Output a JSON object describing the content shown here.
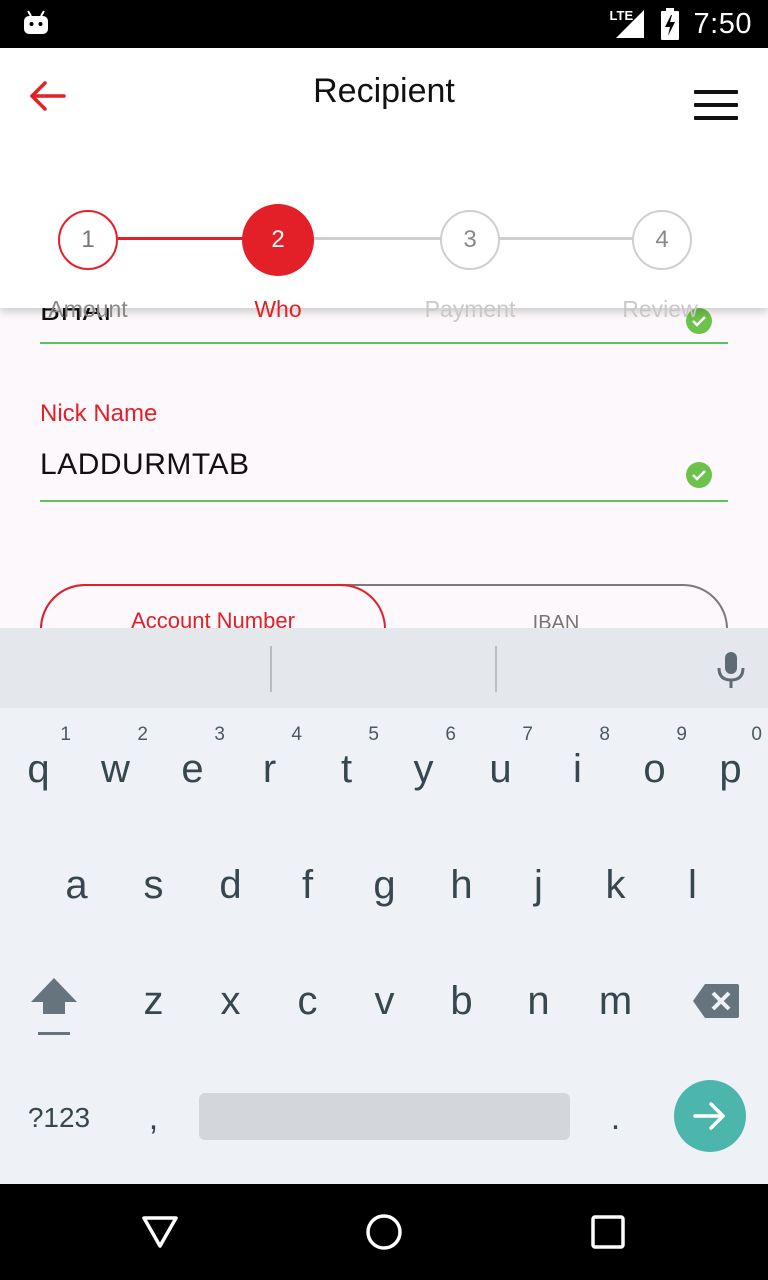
{
  "status_bar": {
    "time": "7:50",
    "network": "LTE",
    "app_icon": "android-robot-icon",
    "signal_icon": "cell-signal-icon",
    "battery_icon": "battery-charging-icon"
  },
  "header": {
    "title": "Recipient",
    "back_icon": "arrow-left-icon",
    "menu_icon": "hamburger-menu-icon"
  },
  "stepper": {
    "active_index": 1,
    "steps": [
      {
        "number": "1",
        "label": "Amount",
        "state": "done"
      },
      {
        "number": "2",
        "label": "Who",
        "state": "active"
      },
      {
        "number": "3",
        "label": "Payment",
        "state": "pending"
      },
      {
        "number": "4",
        "label": "Review",
        "state": "pending"
      }
    ]
  },
  "form": {
    "field_1_value": "BHAI",
    "nick_name_label": "Nick Name",
    "nick_name_value": "LADDURMTAB",
    "toggle": {
      "account_number": "Account Number",
      "iban": "IBAN"
    }
  },
  "keyboard": {
    "row1": [
      {
        "ch": "q",
        "hint": "1"
      },
      {
        "ch": "w",
        "hint": "2"
      },
      {
        "ch": "e",
        "hint": "3"
      },
      {
        "ch": "r",
        "hint": "4"
      },
      {
        "ch": "t",
        "hint": "5"
      },
      {
        "ch": "y",
        "hint": "6"
      },
      {
        "ch": "u",
        "hint": "7"
      },
      {
        "ch": "i",
        "hint": "8"
      },
      {
        "ch": "o",
        "hint": "9"
      },
      {
        "ch": "p",
        "hint": "0"
      }
    ],
    "row2": [
      "a",
      "s",
      "d",
      "f",
      "g",
      "h",
      "j",
      "k",
      "l"
    ],
    "row3": [
      "z",
      "x",
      "c",
      "v",
      "b",
      "n",
      "m"
    ],
    "symbols_label": "?123",
    "comma": ",",
    "period": ".",
    "shift_icon": "shift-arrow-icon",
    "backspace_icon": "backspace-icon",
    "mic_icon": "microphone-icon",
    "enter_icon": "arrow-right-icon"
  },
  "nav_bar": {
    "back_icon": "triangle-back-icon",
    "home_icon": "circle-home-icon",
    "recents_icon": "square-recents-icon"
  },
  "colors": {
    "accent": "#e32027",
    "success": "#6cc24a",
    "enter_key": "#4db6ac"
  }
}
